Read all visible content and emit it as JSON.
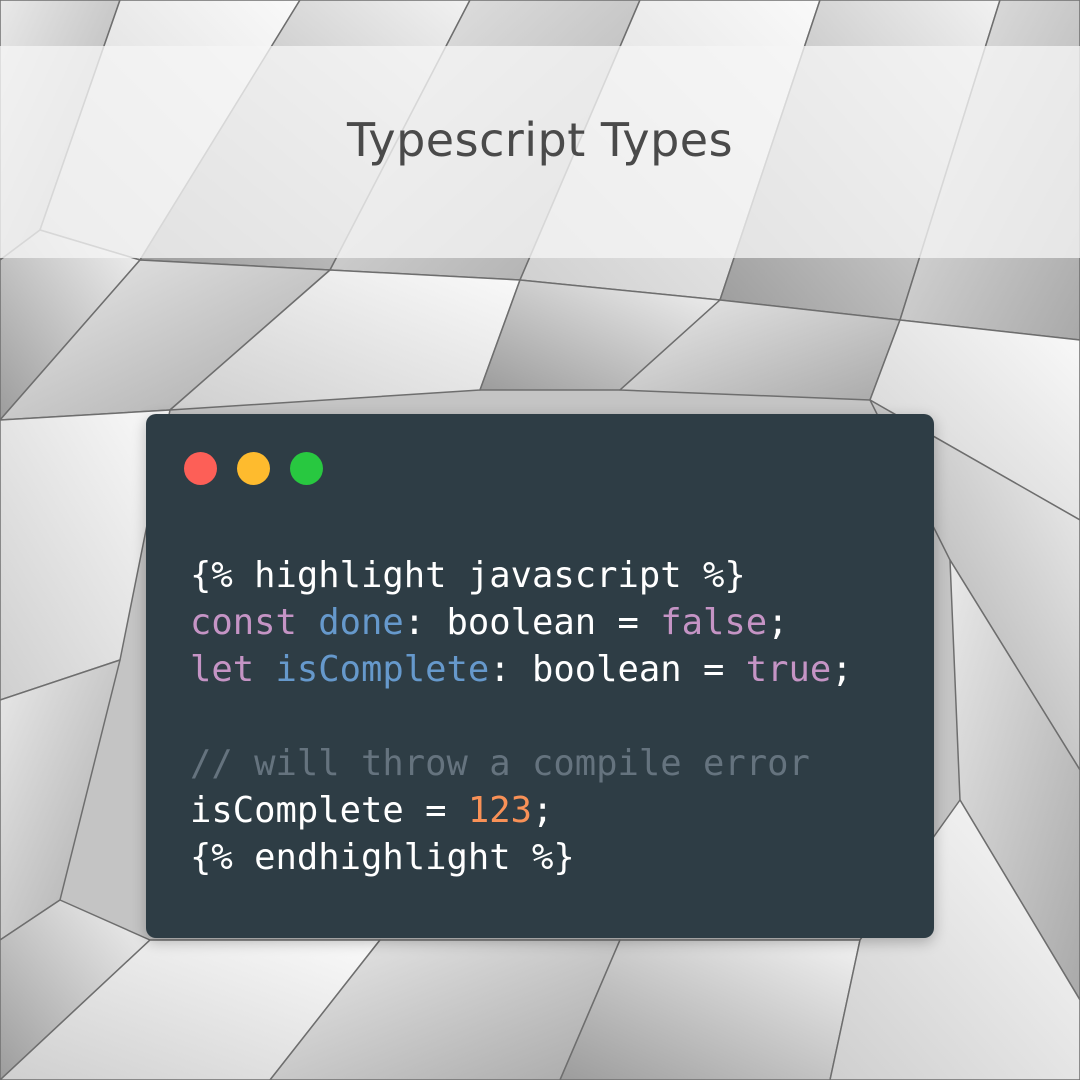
{
  "title": "Typescript Types",
  "colors": {
    "code_background": "#2e3d45",
    "keyword": "#c594c5",
    "variable": "#6699cc",
    "number": "#f99157",
    "comment": "#65737e",
    "plain": "#ffffff",
    "dot_red": "#fd5f57",
    "dot_yellow": "#febb2e",
    "dot_green": "#28c840"
  },
  "window_controls": [
    "close-dot",
    "minimize-dot",
    "maximize-dot"
  ],
  "code_lines": [
    [
      {
        "text": "{% highlight javascript %}",
        "kind": "plain"
      }
    ],
    [
      {
        "text": "const ",
        "kind": "keyword"
      },
      {
        "text": "done",
        "kind": "variable"
      },
      {
        "text": ": boolean = ",
        "kind": "plain"
      },
      {
        "text": "false",
        "kind": "boolean"
      },
      {
        "text": ";",
        "kind": "plain"
      }
    ],
    [
      {
        "text": "let ",
        "kind": "keyword"
      },
      {
        "text": "isComplete",
        "kind": "variable"
      },
      {
        "text": ": boolean = ",
        "kind": "plain"
      },
      {
        "text": "true",
        "kind": "boolean"
      },
      {
        "text": ";",
        "kind": "plain"
      }
    ],
    [],
    [
      {
        "text": "// will throw a compile error",
        "kind": "comment"
      }
    ],
    [
      {
        "text": "isComplete = ",
        "kind": "plain"
      },
      {
        "text": "123",
        "kind": "number"
      },
      {
        "text": ";",
        "kind": "plain"
      }
    ],
    [
      {
        "text": "{% endhighlight %}",
        "kind": "plain"
      }
    ]
  ]
}
